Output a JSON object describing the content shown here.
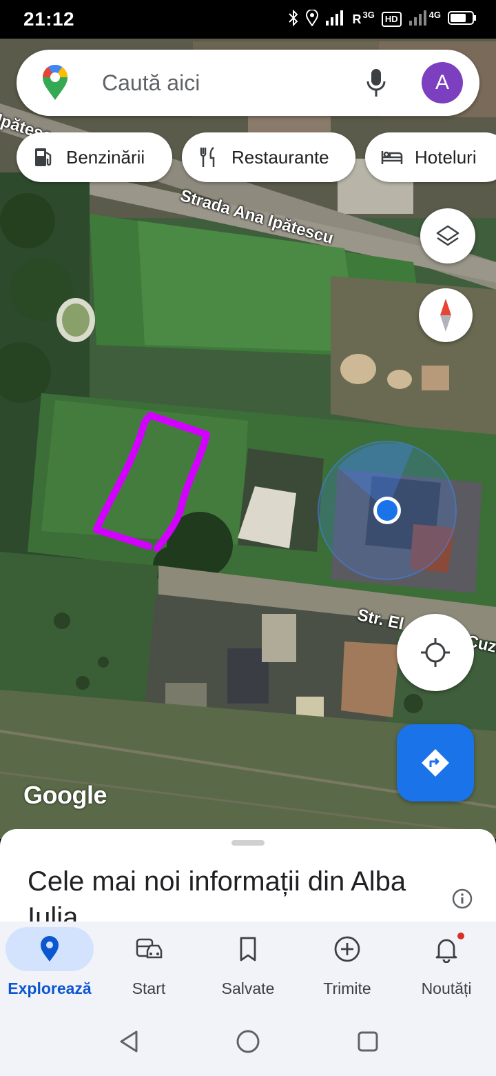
{
  "status_bar": {
    "time": "21:12",
    "network_r": "R",
    "net_3g": "3G",
    "hd": "HD",
    "net_4g": "4G"
  },
  "search": {
    "placeholder": "Caută aici",
    "avatar_letter": "A"
  },
  "chips": [
    {
      "label": "Benzinării",
      "icon": "fuel-icon"
    },
    {
      "label": "Restaurante",
      "icon": "restaurant-icon"
    },
    {
      "label": "Hoteluri",
      "icon": "hotel-icon"
    }
  ],
  "map": {
    "streets": [
      "Strada Ana Ipătescu",
      "Str. El",
      "Cuza",
      "Ipătesc"
    ],
    "logo": "Google"
  },
  "sheet": {
    "title": "Cele mai noi informații din Alba Iulia"
  },
  "bottom_nav": [
    {
      "label": "Explorează",
      "icon": "location-pin-icon",
      "active": true
    },
    {
      "label": "Start",
      "icon": "commute-icon",
      "active": false
    },
    {
      "label": "Salvate",
      "icon": "bookmark-icon",
      "active": false
    },
    {
      "label": "Trimite",
      "icon": "add-circle-icon",
      "active": false
    },
    {
      "label": "Noutăți",
      "icon": "bell-icon",
      "active": false
    }
  ],
  "colors": {
    "accent": "#1a73e8",
    "highlight_outline": "#d400ff",
    "avatar": "#7b3fbf"
  }
}
